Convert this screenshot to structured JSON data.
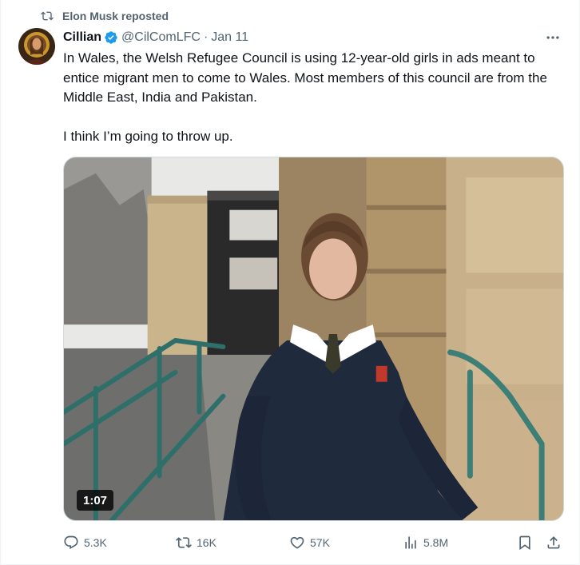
{
  "social_context": {
    "icon": "repost-icon",
    "text": "Elon Musk reposted"
  },
  "author": {
    "name": "Cillian",
    "verified": true,
    "handle": "@CilComLFC",
    "separator": "·",
    "date": "Jan 11",
    "avatar_icon": "avatar-icon"
  },
  "more_icon": "more-icon",
  "tweet": {
    "paragraph1": "In Wales, the Welsh Refugee Council is using 12-year-old girls in ads meant to entice migrant men to come to Wales. Most members of this council are from the Middle East, India and Pakistan.",
    "paragraph2": "I think I’m going to throw up."
  },
  "media": {
    "type": "video",
    "duration": "1:07"
  },
  "actions": {
    "reply": {
      "icon": "reply-icon",
      "count": "5.3K"
    },
    "repost": {
      "icon": "repost-icon",
      "count": "16K"
    },
    "like": {
      "icon": "heart-icon",
      "count": "57K"
    },
    "views": {
      "icon": "views-icon",
      "count": "5.8M"
    },
    "bookmark": {
      "icon": "bookmark-icon"
    },
    "share": {
      "icon": "share-icon"
    }
  },
  "colors": {
    "text": "#0f1419",
    "secondary": "#536471",
    "verified": "#1d9bf0",
    "border": "#cfd9de"
  }
}
